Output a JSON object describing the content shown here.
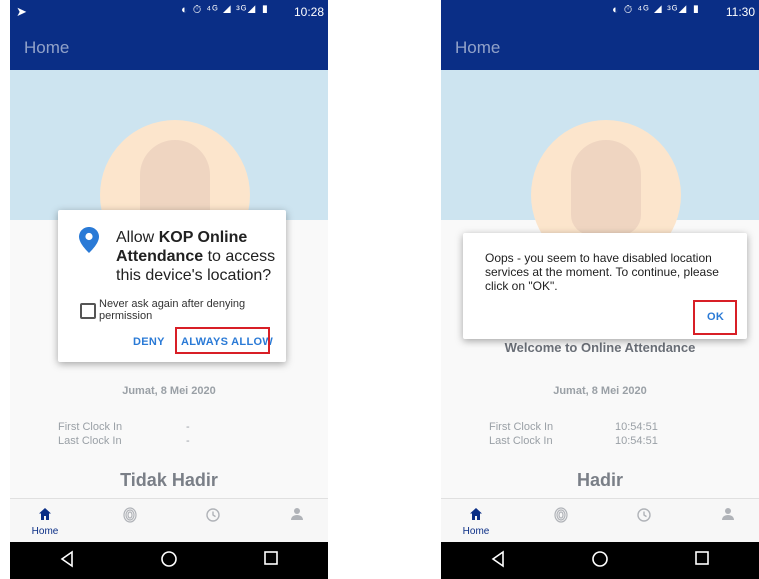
{
  "left_phone": {
    "status": {
      "nav_icon": "➤",
      "sys_icons": "◐ ⏱ ⁴ᴳ ◢ ³ᴳ◢ ▮",
      "time": "10:28"
    },
    "appbar_title": "Home",
    "date": "Jumat, 8 Mei 2020",
    "first_clock_label": "First Clock In",
    "last_clock_label": "Last Clock In",
    "first_clock_value": "-",
    "last_clock_value": "-",
    "status_text": "Tidak Hadir",
    "dialog": {
      "prefix": "Allow ",
      "app_name": "KOP Online Attendance",
      "suffix": " to access this device's location?",
      "checkbox_label": "Never ask again after denying permission",
      "deny": "DENY",
      "always_allow": "ALWAYS ALLOW"
    }
  },
  "right_phone": {
    "status": {
      "sys_icons": "◐ ⏱ ⁴ᴳ ◢ ³ᴳ◢ ▮",
      "time": "11:30"
    },
    "appbar_title": "Home",
    "welcome": "Welcome to Online Attendance",
    "date": "Jumat, 8 Mei 2020",
    "first_clock_label": "First Clock In",
    "last_clock_label": "Last Clock In",
    "first_clock_value": "10:54:51",
    "last_clock_value": "10:54:51",
    "status_text": "Hadir",
    "dialog": {
      "message": "Oops - you seem to have disabled location services at the moment. To continue, please click on \"OK\".",
      "ok": "OK"
    }
  },
  "bottom_nav": {
    "home_label": "Home",
    "icons": [
      "home-icon",
      "fingerprint-icon",
      "history-icon",
      "profile-icon"
    ]
  },
  "colors": {
    "appbar": "#0a2e86",
    "accent": "#2a7ad6",
    "highlight": "#d81f26"
  }
}
